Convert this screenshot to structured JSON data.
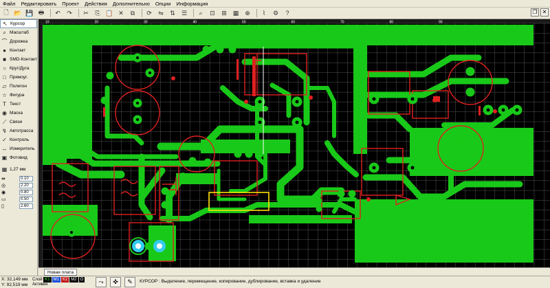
{
  "menu": [
    "Файл",
    "Редактировать",
    "Проект",
    "Действия",
    "Дополнительно",
    "Опции",
    "Информация"
  ],
  "window_controls": {
    "restore": "❐",
    "close": "✕"
  },
  "toolbar_icons": [
    "new-file-icon",
    "open-file-icon",
    "save-icon",
    "print-icon",
    "undo-icon",
    "redo-icon",
    "cut-icon",
    "copy-icon",
    "paste-icon",
    "delete-icon",
    "duplicate-icon",
    "rotate-icon",
    "mirror-horizontal-icon",
    "mirror-vertical-icon",
    "align-icon",
    "zoom-icon",
    "zoom-fit-icon",
    "zoom-previous-icon",
    "grid-icon",
    "magnet-icon",
    "wire-icon",
    "gear-icon",
    "help-icon"
  ],
  "tools": [
    {
      "label": "Курсор",
      "icon": "cursor-icon",
      "glyph": "↖"
    },
    {
      "label": "Масштаб",
      "icon": "zoom-icon",
      "glyph": "⌕"
    },
    {
      "label": "Дорожка",
      "icon": "track-icon",
      "glyph": "⌒"
    },
    {
      "label": "Контакт",
      "icon": "pad-icon",
      "glyph": "●"
    },
    {
      "label": "SMD-Контакт",
      "icon": "smd-pad-icon",
      "glyph": "■"
    },
    {
      "label": "Круг/Дуга",
      "icon": "circle-arc-icon",
      "glyph": "○"
    },
    {
      "label": "Прямоуг.",
      "icon": "rectangle-icon",
      "glyph": "□"
    },
    {
      "label": "Полигон",
      "icon": "polygon-icon",
      "glyph": "▱"
    },
    {
      "label": "Фигура",
      "icon": "shape-icon",
      "glyph": "☆"
    },
    {
      "label": "Текст",
      "icon": "text-icon",
      "glyph": "T"
    },
    {
      "label": "Маска",
      "icon": "mask-icon",
      "glyph": "◉"
    },
    {
      "label": "Связи",
      "icon": "connections-icon",
      "glyph": "⟋"
    },
    {
      "label": "Автотрасса",
      "icon": "autoroute-icon",
      "glyph": "↯"
    },
    {
      "label": "Контроль",
      "icon": "check-icon",
      "glyph": "✓"
    },
    {
      "label": "Измеритель",
      "icon": "measure-icon",
      "glyph": "↔"
    },
    {
      "label": "Фотовид",
      "icon": "photo-view-icon",
      "glyph": "▣"
    }
  ],
  "grid": {
    "label": "1,27 мм"
  },
  "params": [
    {
      "icon": "track-width-icon",
      "value": "0.10"
    },
    {
      "icon": "pad-outer-icon",
      "value": "2.20"
    },
    {
      "icon": "pad-inner-icon",
      "value": "0.80"
    },
    {
      "icon": "smd-width-icon",
      "value": "0.50"
    },
    {
      "icon": "smd-height-icon",
      "value": "2.60"
    }
  ],
  "ruler": {
    "labels": [
      "10",
      "20",
      "30",
      "40",
      "50",
      "60",
      "70",
      "80",
      "90"
    ]
  },
  "board_tab": "Новая плата",
  "status": {
    "x": "32,149 мм",
    "y": "92,519 мм",
    "layer_label": "Слой",
    "active_label": "Активен",
    "layers": [
      "K1",
      "M1",
      "K2",
      "M2",
      "O"
    ],
    "text": "КУРСОР : Выделение, перемещение, копирование, дублирование, вставка и удаление"
  },
  "colors": {
    "copper": "#19c919",
    "background": "#000000",
    "silkscreen": "#e02020",
    "pad_ring": "#19c919",
    "grid": "#6a6a6a",
    "selection": "#ffe000",
    "via": "#33ccee"
  }
}
